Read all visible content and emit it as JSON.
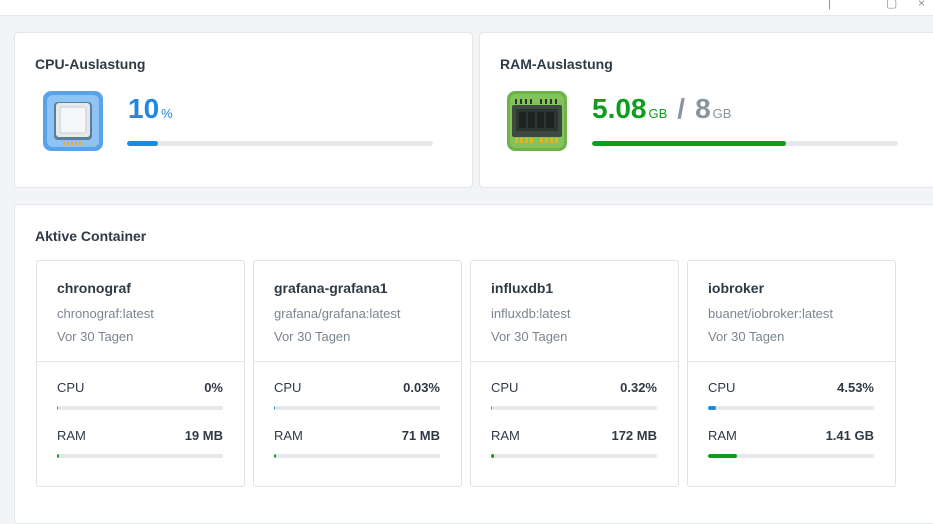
{
  "topbar": {
    "icons": [
      "minimize-icon",
      "close-icon"
    ]
  },
  "cpu": {
    "title": "CPU-Auslastung",
    "value": "10",
    "unit": "%",
    "percent": 10,
    "icon": "cpu-chip-icon",
    "color": "#1e88e5"
  },
  "ram": {
    "title": "RAM-Auslastung",
    "used": "5.08",
    "used_unit": "GB",
    "separator": "/",
    "total": "8",
    "total_unit": "GB",
    "percent": 63.5,
    "icon": "ram-module-icon",
    "color": "#0f9d1f"
  },
  "containers": {
    "title": "Aktive Container",
    "items": [
      {
        "name": "chronograf",
        "image": "chronograf:latest",
        "age": "Vor 30 Tagen",
        "cpu_label": "CPU",
        "cpu_value": "0%",
        "cpu_pct": 0,
        "ram_label": "RAM",
        "ram_value": "19 MB",
        "ram_pct": 1
      },
      {
        "name": "grafana-grafana1",
        "image": "grafana/grafana:latest",
        "age": "Vor 30 Tagen",
        "cpu_label": "CPU",
        "cpu_value": "0.03%",
        "cpu_pct": 0.03,
        "ram_label": "RAM",
        "ram_value": "71 MB",
        "ram_pct": 1
      },
      {
        "name": "influxdb1",
        "image": "influxdb:latest",
        "age": "Vor 30 Tagen",
        "cpu_label": "CPU",
        "cpu_value": "0.32%",
        "cpu_pct": 0.32,
        "ram_label": "RAM",
        "ram_value": "172 MB",
        "ram_pct": 2
      },
      {
        "name": "iobroker",
        "image": "buanet/iobroker:latest",
        "age": "Vor 30 Tagen",
        "cpu_label": "CPU",
        "cpu_value": "4.53%",
        "cpu_pct": 4.53,
        "ram_label": "RAM",
        "ram_value": "1.41 GB",
        "ram_pct": 17.6
      }
    ]
  }
}
